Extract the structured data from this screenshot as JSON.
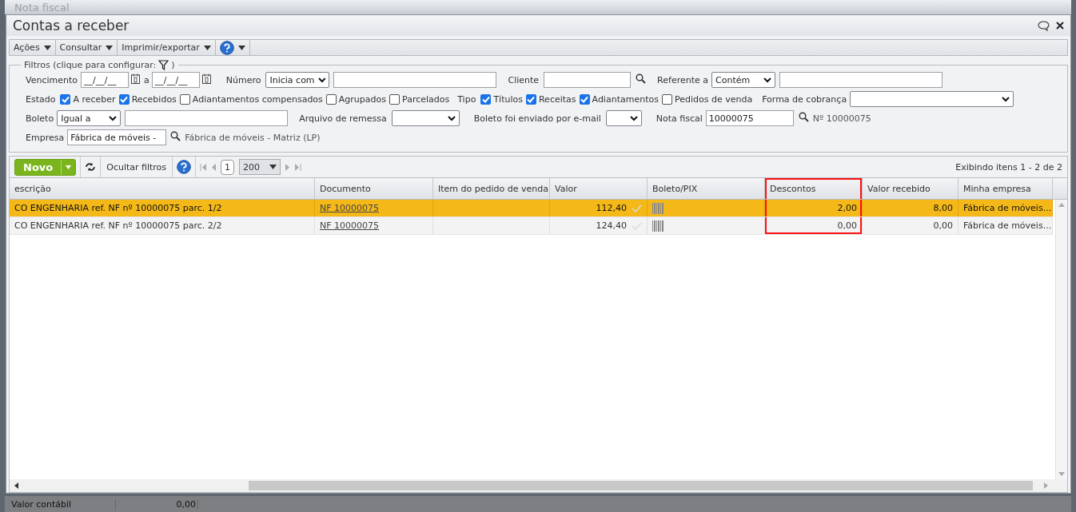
{
  "background_window": {
    "title": "Nota fiscal"
  },
  "window": {
    "title": "Contas a receber"
  },
  "menu": [
    {
      "label": "Ações",
      "kind": "dropdown"
    },
    {
      "label": "Consultar",
      "kind": "dropdown"
    },
    {
      "label": "Imprimir/exportar",
      "kind": "dropdown"
    },
    {
      "kind": "help"
    }
  ],
  "filters": {
    "legend": "Filtros (clique para configurar:",
    "legend_close": ")",
    "vencimento": {
      "label": "Vencimento",
      "from": "__/__/__",
      "separator": "a",
      "to": "__/__/__"
    },
    "numero": {
      "label": "Número",
      "operator": "Inicia com"
    },
    "cliente": {
      "label": "Cliente"
    },
    "referente": {
      "label": "Referente a",
      "operator": "Contém"
    },
    "estado": {
      "label": "Estado",
      "options": [
        {
          "label": "A receber",
          "checked": true
        },
        {
          "label": "Recebidos",
          "checked": true
        },
        {
          "label": "Adiantamentos compensados",
          "checked": false
        },
        {
          "label": "Agrupados",
          "checked": false
        },
        {
          "label": "Parcelados",
          "checked": false
        }
      ]
    },
    "tipo": {
      "label": "Tipo",
      "options": [
        {
          "label": "Títulos",
          "checked": true
        },
        {
          "label": "Receitas",
          "checked": true
        },
        {
          "label": "Adiantamentos",
          "checked": true
        },
        {
          "label": "Pedidos de venda",
          "checked": false
        }
      ]
    },
    "forma_cobranca": {
      "label": "Forma de cobrança"
    },
    "boleto": {
      "label": "Boleto",
      "operator": "Igual a"
    },
    "arquivo_remessa": {
      "label": "Arquivo de remessa"
    },
    "boleto_email": {
      "label": "Boleto foi enviado por e-mail"
    },
    "nota_fiscal": {
      "label": "Nota fiscal",
      "value": "10000075",
      "result": "Nº 10000075"
    },
    "empresa": {
      "label": "Empresa",
      "value": "Fábrica de móveis -",
      "result": "Fábrica de móveis - Matriz (LP)"
    }
  },
  "toolbar": {
    "new_button": "Novo",
    "hide_filters": "Ocultar filtros",
    "page": "1",
    "page_size": "200",
    "item_count": "Exibindo itens 1 - 2 de 2"
  },
  "table": {
    "columns": [
      {
        "label": "escrição",
        "highlighted": false
      },
      {
        "label": "Documento",
        "highlighted": false
      },
      {
        "label": "Item do pedido de venda",
        "highlighted": false
      },
      {
        "label": "Valor",
        "highlighted": false
      },
      {
        "label": "Boleto/PIX",
        "highlighted": false
      },
      {
        "label": "Descontos",
        "highlighted": true
      },
      {
        "label": "Valor recebido",
        "highlighted": false
      },
      {
        "label": "Minha empresa",
        "highlighted": false
      }
    ],
    "rows": [
      {
        "selected": true,
        "descricao": "CO ENGENHARIA ref. NF nº 10000075 parc. 1/2",
        "documento": "NF 10000075",
        "valor": "112,40",
        "descontos": "2,00",
        "valor_recebido": "8,00",
        "empresa": "Fábrica de móveis..."
      },
      {
        "selected": false,
        "descricao": "CO ENGENHARIA ref. NF nº 10000075 parc. 2/2",
        "documento": "NF 10000075",
        "valor": "124,40",
        "descontos": "0,00",
        "valor_recebido": "0,00",
        "empresa": "Fábrica de móveis..."
      }
    ]
  },
  "status_bar": {
    "label": "Valor contábil",
    "value": "0,00"
  }
}
